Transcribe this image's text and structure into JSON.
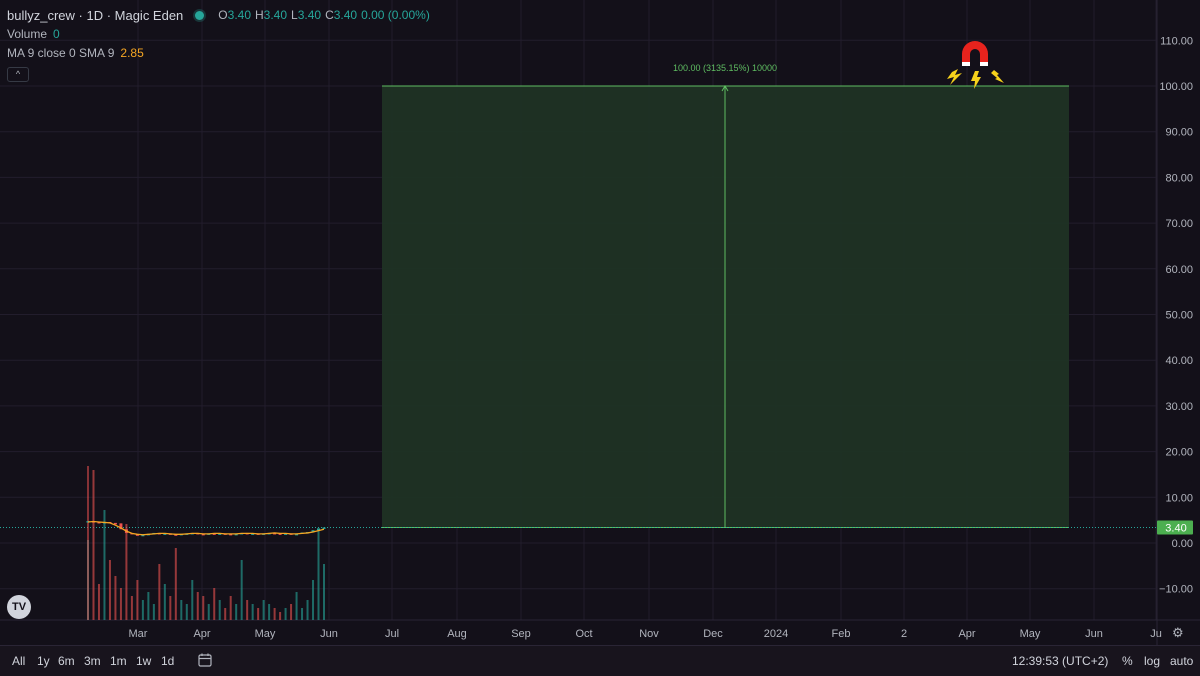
{
  "legend": {
    "title": "bullyz_crew · 1D · Magic Eden",
    "ohlc": [
      {
        "key": "O",
        "value": "3.40"
      },
      {
        "key": "H",
        "value": "3.40"
      },
      {
        "key": "L",
        "value": "3.40"
      },
      {
        "key": "C",
        "value": "3.40"
      },
      {
        "key": "",
        "value": "0.00 (0.00%)"
      }
    ],
    "volume_label": "Volume",
    "volume_value": "0",
    "ma_label": "MA 9 close 0 SMA 9",
    "ma_value": "2.85"
  },
  "colors": {
    "background": "#131019",
    "grid": "#221d2c",
    "up": "#26a69a",
    "down": "#ef5350",
    "ma_line": "#f5a623",
    "long_fill": "#1f3324",
    "long_border": "#5fbd62",
    "price_tag": "#4caf50"
  },
  "chart_data": {
    "type": "line",
    "title": "",
    "xlabel": "",
    "ylabel": "",
    "ylim": [
      -15,
      115
    ],
    "y_ticks": [
      "110.00",
      "100.00",
      "90.00",
      "80.00",
      "70.00",
      "60.00",
      "50.00",
      "40.00",
      "30.00",
      "20.00",
      "10.00",
      "0.00",
      "−10.00"
    ],
    "y_tick_values": [
      110,
      100,
      90,
      80,
      70,
      60,
      50,
      40,
      30,
      20,
      10,
      0,
      -10
    ],
    "x_ticks": [
      "Mar",
      "Apr",
      "May",
      "Jun",
      "Jul",
      "Aug",
      "Sep",
      "Oct",
      "Nov",
      "Dec",
      "2024",
      "Feb",
      "2",
      "Apr",
      "May",
      "Jun",
      "Ju"
    ],
    "current_price": 3.4,
    "current_price_label": "3.40",
    "series": [
      {
        "values": [
          4.6,
          4.7,
          4.6,
          4.5,
          4.4,
          3.9,
          3.3,
          2.6,
          2.1,
          1.9,
          1.8,
          1.9,
          2.0,
          2.1,
          2.1,
          2.0,
          1.9,
          1.9,
          2.0,
          2.1,
          2.1,
          2.0,
          2.0,
          2.1,
          2.1,
          2.0,
          2.0,
          2.0,
          2.1,
          2.1,
          2.1,
          2.0,
          2.0,
          2.1,
          2.2,
          2.1,
          2.1,
          2.0,
          2.0,
          2.1,
          2.2,
          2.4,
          2.7,
          3.0
        ]
      }
    ],
    "candles_close": [
      4.8,
      4.6,
      4.5,
      4.6,
      4.4,
      4.3,
      3.0,
      2.2,
      1.9,
      1.7,
      1.8,
      2.0,
      2.2,
      2.0,
      2.1,
      1.9,
      1.8,
      2.0,
      2.1,
      2.2,
      2.0,
      1.9,
      2.1,
      2.0,
      2.1,
      2.0,
      1.9,
      2.0,
      2.2,
      2.0,
      2.1,
      1.9,
      2.1,
      2.2,
      2.1,
      2.0,
      2.1,
      1.9,
      2.0,
      2.3,
      2.4,
      2.8,
      3.2,
      3.4
    ],
    "volume": [
      40,
      75,
      18,
      55,
      30,
      22,
      16,
      48,
      12,
      20,
      10,
      14,
      8,
      28,
      18,
      12,
      36,
      10,
      8,
      20,
      14,
      12,
      8,
      16,
      10,
      6,
      12,
      8,
      30,
      10,
      8,
      6,
      10,
      8,
      6,
      4,
      6,
      8,
      14,
      6,
      10,
      20,
      45,
      28
    ],
    "long_position": {
      "label": "100.00 (3135.15%) 10000",
      "entry": 3.4,
      "target": 100.0
    }
  },
  "bottom_bar": {
    "ranges": [
      "All",
      "1y",
      "6m",
      "3m",
      "1m",
      "1w",
      "1d"
    ],
    "time": "12:39:53 (UTC+2)",
    "options": [
      "%",
      "log",
      "auto"
    ]
  },
  "icons": {
    "logo": "TV",
    "collapse": "^",
    "settings": "⚙"
  }
}
